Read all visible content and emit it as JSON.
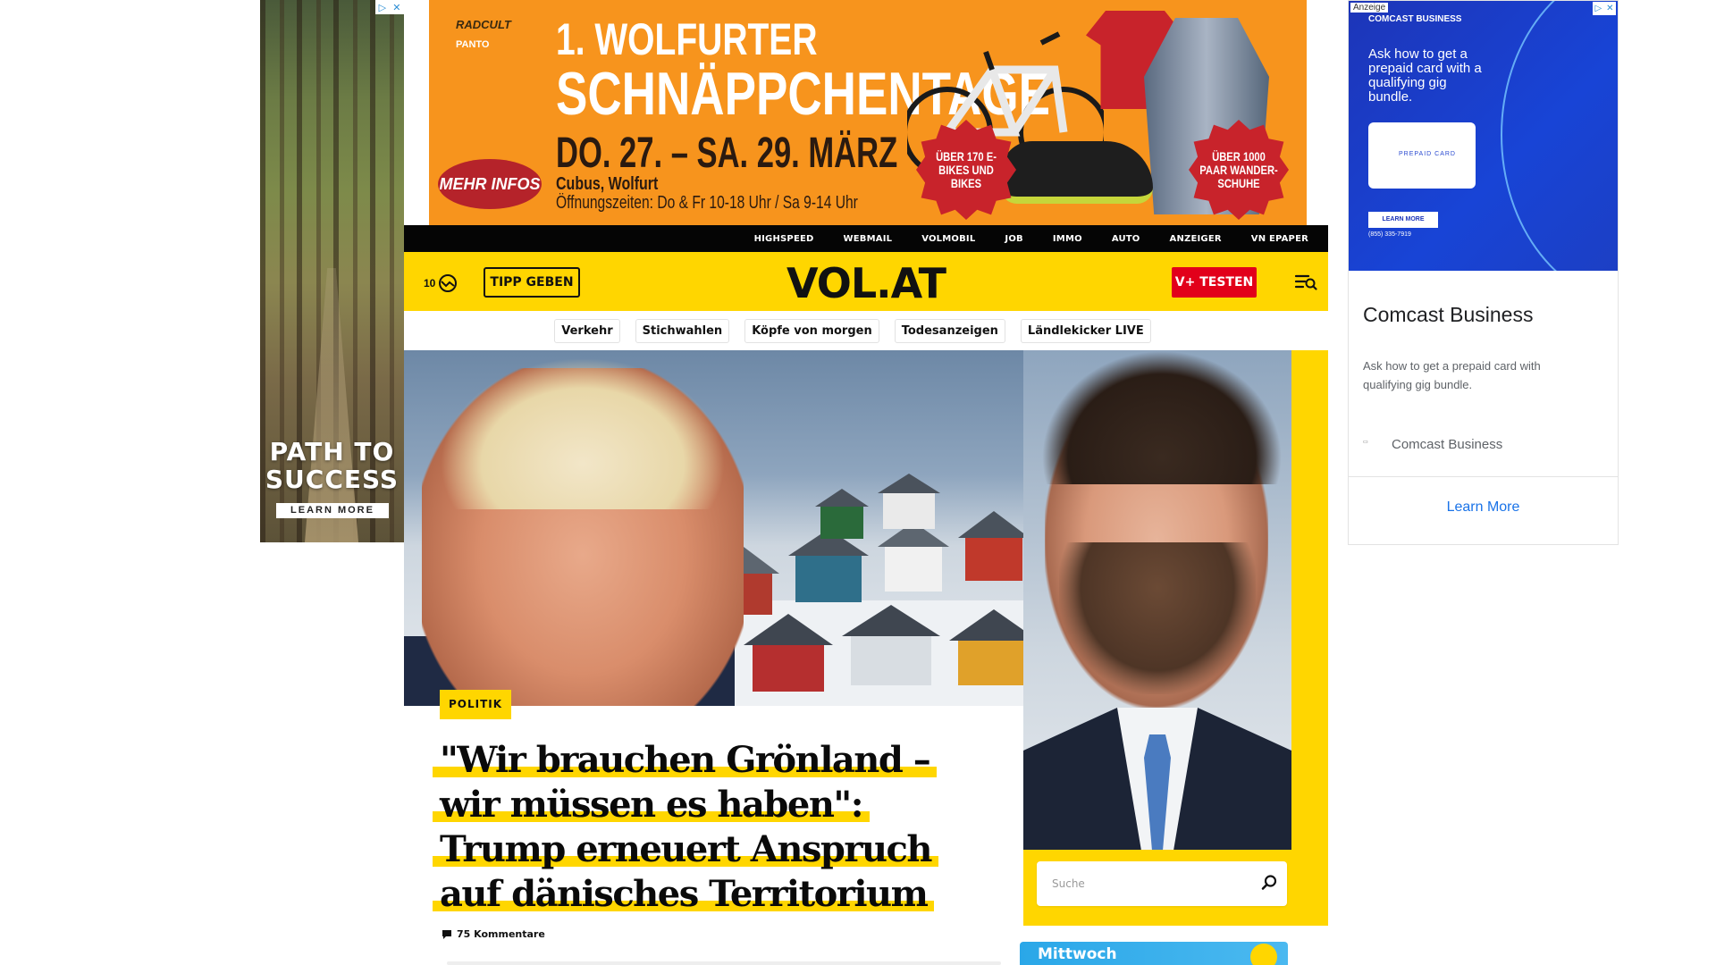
{
  "ads": {
    "left": {
      "headline_line1": "PATH TO",
      "headline_line2": "SUCCESS",
      "cta": "LEARN MORE"
    },
    "top": {
      "brand1": "RADCULT",
      "brand2": "PANTO",
      "title_line1": "1. WOLFURTER",
      "title_line2": "SCHNÄPPCHENTAGE",
      "dates": "DO. 27. – SA. 29. MÄRZ",
      "location": "Cubus, Wolfurt",
      "hours": "Öffnungszeiten: Do & Fr 10-18 Uhr / Sa 9-14 Uhr",
      "cta": "MEHR INFOS",
      "badge1": "ÜBER 170 E-BIKES UND BIKES",
      "badge2": "ÜBER 1000 PAAR WANDER-SCHUHE"
    },
    "right": {
      "label": "Anzeige",
      "image_brand": "COMCAST BUSINESS",
      "image_text": "Ask how to get a prepaid card with a qualifying gig bundle.",
      "card_label": "PREPAID CARD",
      "image_cta": "LEARN MORE",
      "phone": "(855) 335-7919",
      "title": "Comcast Business",
      "description": "Ask how to get a prepaid card with qualifying gig bundle.",
      "advertiser": "Comcast Business",
      "cta": "Learn More",
      "colors": {
        "blue": "#1c3fc4",
        "link": "#1a73e8"
      }
    }
  },
  "site": {
    "top_links": [
      "HIGHSPEED",
      "WEBMAIL",
      "VOLMOBIL",
      "JOB",
      "IMMO",
      "AUTO",
      "ANZEIGER",
      "VN EPAPER"
    ],
    "temperature": "10",
    "tip_button": "TIPP GEBEN",
    "logo": "VOL.AT",
    "vplus_button": "V+ TESTEN",
    "topics": [
      "Verkehr",
      "Stichwahlen",
      "Köpfe von morgen",
      "Todesanzeigen",
      "Ländlekicker LIVE"
    ],
    "colors": {
      "brand_yellow": "#ffd600",
      "accent_red": "#e2001a",
      "strip": "#050505"
    }
  },
  "article": {
    "category": "POLITIK",
    "headline": "\"Wir brauchen Grönland – wir müssen es haben\": Trump erneuert Anspruch auf dänisches Territorium",
    "comments": "75 Kommentare"
  },
  "search": {
    "placeholder": "Suche"
  },
  "weather_widget": {
    "day": "Mittwoch"
  }
}
